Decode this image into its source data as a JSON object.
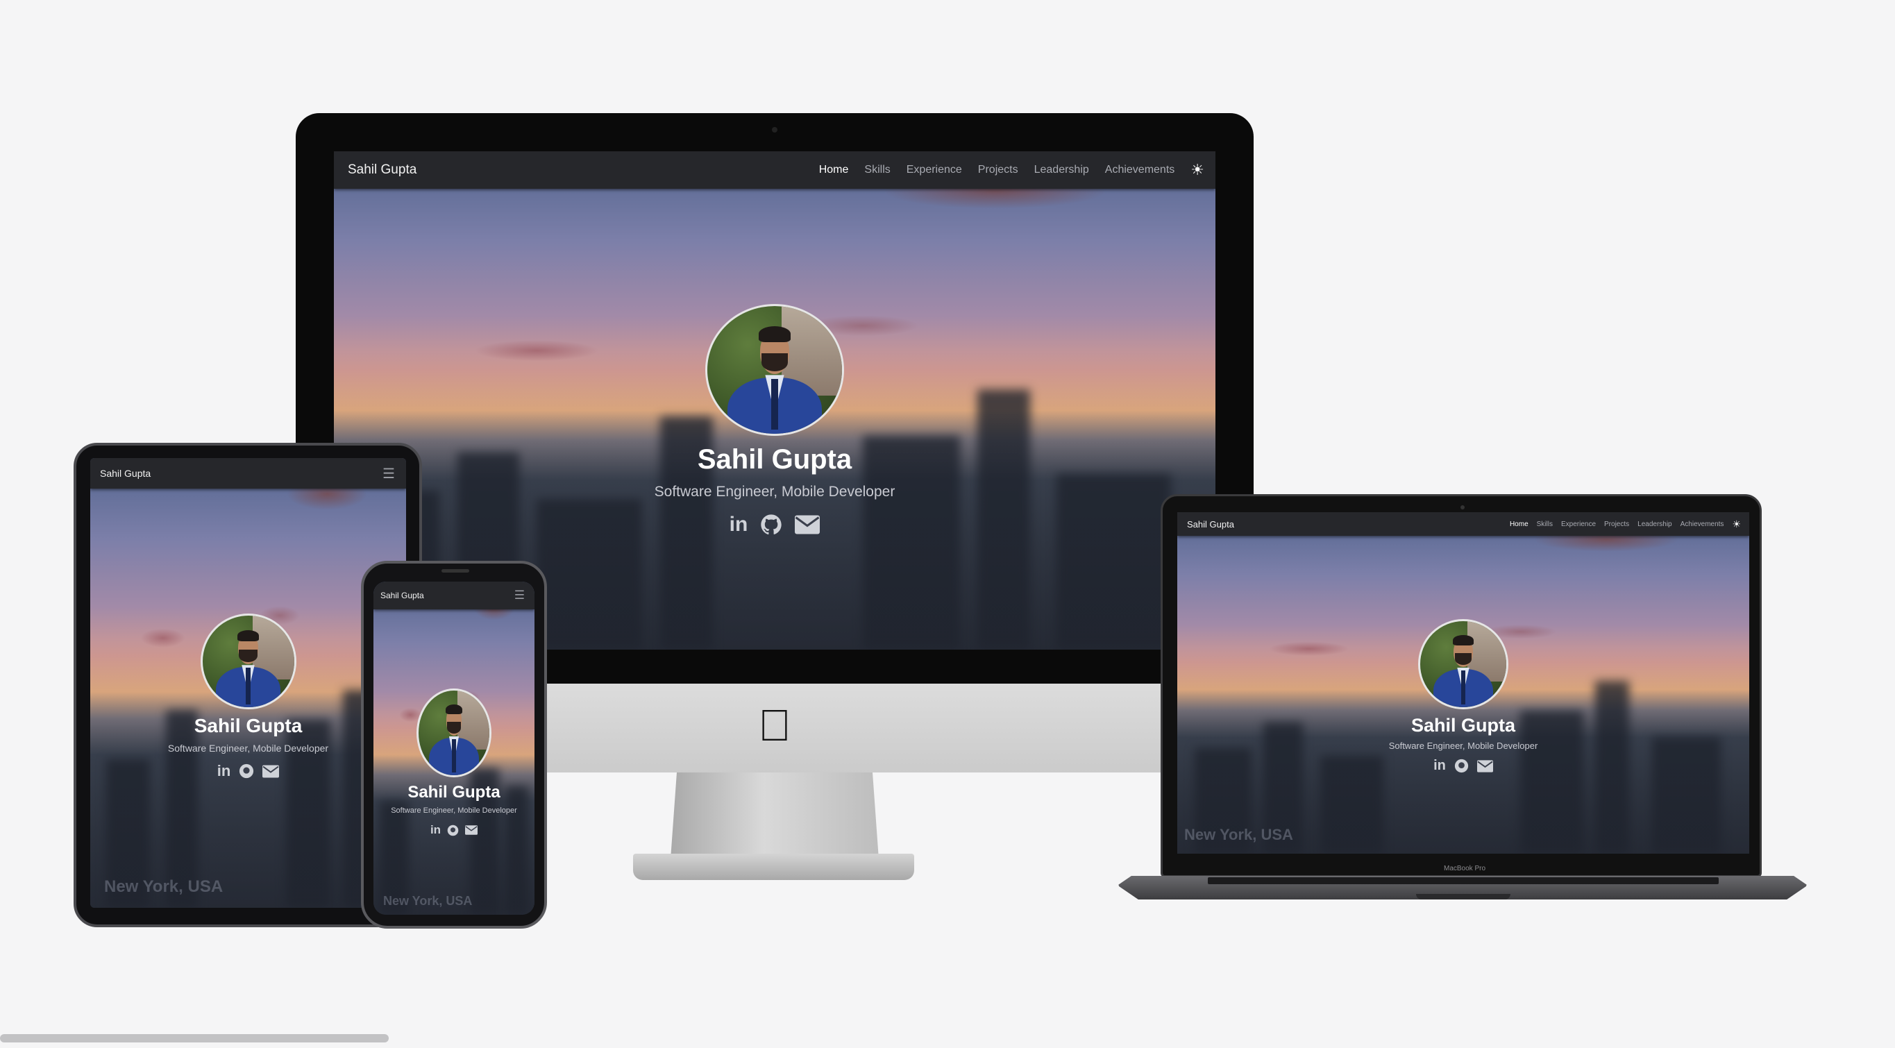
{
  "site": {
    "brand": "Sahil Gupta",
    "nav": [
      "Home",
      "Skills",
      "Experience",
      "Projects",
      "Leadership",
      "Achievements"
    ],
    "active_nav": "Home",
    "hero": {
      "name": "Sahil Gupta",
      "subtitle": "Software Engineer, Mobile Developer",
      "location": "New York, USA"
    },
    "social_icons": [
      "linkedin-icon",
      "github-icon",
      "email-icon"
    ],
    "theme_toggle_icon": "sun-icon",
    "menu_icon": "hamburger-icon"
  },
  "device_labels": {
    "macbook": "MacBook Pro"
  },
  "colors": {
    "navbar": "#26272b",
    "nav_active": "#ffffff",
    "nav_inactive": "#a9abb2",
    "page_background": "#f5f5f6"
  }
}
